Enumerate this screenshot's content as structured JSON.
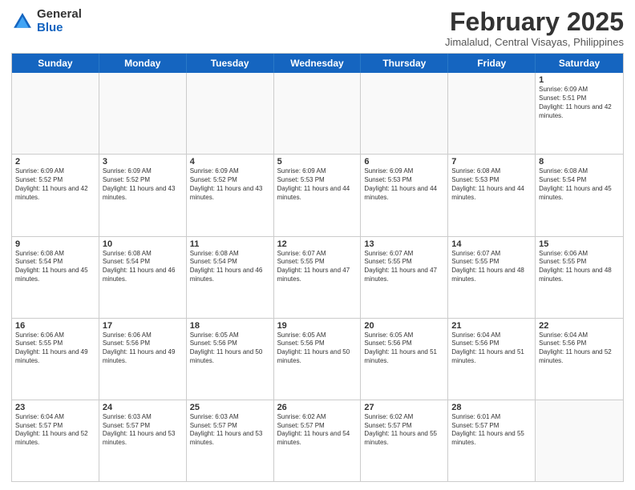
{
  "logo": {
    "general": "General",
    "blue": "Blue"
  },
  "title": "February 2025",
  "subtitle": "Jimalalud, Central Visayas, Philippines",
  "days_of_week": [
    "Sunday",
    "Monday",
    "Tuesday",
    "Wednesday",
    "Thursday",
    "Friday",
    "Saturday"
  ],
  "weeks": [
    [
      {
        "day": "",
        "empty": true
      },
      {
        "day": "",
        "empty": true
      },
      {
        "day": "",
        "empty": true
      },
      {
        "day": "",
        "empty": true
      },
      {
        "day": "",
        "empty": true
      },
      {
        "day": "",
        "empty": true
      },
      {
        "day": "1",
        "sunrise": "Sunrise: 6:09 AM",
        "sunset": "Sunset: 5:51 PM",
        "daylight": "Daylight: 11 hours and 42 minutes."
      }
    ],
    [
      {
        "day": "2",
        "sunrise": "Sunrise: 6:09 AM",
        "sunset": "Sunset: 5:52 PM",
        "daylight": "Daylight: 11 hours and 42 minutes."
      },
      {
        "day": "3",
        "sunrise": "Sunrise: 6:09 AM",
        "sunset": "Sunset: 5:52 PM",
        "daylight": "Daylight: 11 hours and 43 minutes."
      },
      {
        "day": "4",
        "sunrise": "Sunrise: 6:09 AM",
        "sunset": "Sunset: 5:52 PM",
        "daylight": "Daylight: 11 hours and 43 minutes."
      },
      {
        "day": "5",
        "sunrise": "Sunrise: 6:09 AM",
        "sunset": "Sunset: 5:53 PM",
        "daylight": "Daylight: 11 hours and 44 minutes."
      },
      {
        "day": "6",
        "sunrise": "Sunrise: 6:09 AM",
        "sunset": "Sunset: 5:53 PM",
        "daylight": "Daylight: 11 hours and 44 minutes."
      },
      {
        "day": "7",
        "sunrise": "Sunrise: 6:08 AM",
        "sunset": "Sunset: 5:53 PM",
        "daylight": "Daylight: 11 hours and 44 minutes."
      },
      {
        "day": "8",
        "sunrise": "Sunrise: 6:08 AM",
        "sunset": "Sunset: 5:54 PM",
        "daylight": "Daylight: 11 hours and 45 minutes."
      }
    ],
    [
      {
        "day": "9",
        "sunrise": "Sunrise: 6:08 AM",
        "sunset": "Sunset: 5:54 PM",
        "daylight": "Daylight: 11 hours and 45 minutes."
      },
      {
        "day": "10",
        "sunrise": "Sunrise: 6:08 AM",
        "sunset": "Sunset: 5:54 PM",
        "daylight": "Daylight: 11 hours and 46 minutes."
      },
      {
        "day": "11",
        "sunrise": "Sunrise: 6:08 AM",
        "sunset": "Sunset: 5:54 PM",
        "daylight": "Daylight: 11 hours and 46 minutes."
      },
      {
        "day": "12",
        "sunrise": "Sunrise: 6:07 AM",
        "sunset": "Sunset: 5:55 PM",
        "daylight": "Daylight: 11 hours and 47 minutes."
      },
      {
        "day": "13",
        "sunrise": "Sunrise: 6:07 AM",
        "sunset": "Sunset: 5:55 PM",
        "daylight": "Daylight: 11 hours and 47 minutes."
      },
      {
        "day": "14",
        "sunrise": "Sunrise: 6:07 AM",
        "sunset": "Sunset: 5:55 PM",
        "daylight": "Daylight: 11 hours and 48 minutes."
      },
      {
        "day": "15",
        "sunrise": "Sunrise: 6:06 AM",
        "sunset": "Sunset: 5:55 PM",
        "daylight": "Daylight: 11 hours and 48 minutes."
      }
    ],
    [
      {
        "day": "16",
        "sunrise": "Sunrise: 6:06 AM",
        "sunset": "Sunset: 5:55 PM",
        "daylight": "Daylight: 11 hours and 49 minutes."
      },
      {
        "day": "17",
        "sunrise": "Sunrise: 6:06 AM",
        "sunset": "Sunset: 5:56 PM",
        "daylight": "Daylight: 11 hours and 49 minutes."
      },
      {
        "day": "18",
        "sunrise": "Sunrise: 6:05 AM",
        "sunset": "Sunset: 5:56 PM",
        "daylight": "Daylight: 11 hours and 50 minutes."
      },
      {
        "day": "19",
        "sunrise": "Sunrise: 6:05 AM",
        "sunset": "Sunset: 5:56 PM",
        "daylight": "Daylight: 11 hours and 50 minutes."
      },
      {
        "day": "20",
        "sunrise": "Sunrise: 6:05 AM",
        "sunset": "Sunset: 5:56 PM",
        "daylight": "Daylight: 11 hours and 51 minutes."
      },
      {
        "day": "21",
        "sunrise": "Sunrise: 6:04 AM",
        "sunset": "Sunset: 5:56 PM",
        "daylight": "Daylight: 11 hours and 51 minutes."
      },
      {
        "day": "22",
        "sunrise": "Sunrise: 6:04 AM",
        "sunset": "Sunset: 5:56 PM",
        "daylight": "Daylight: 11 hours and 52 minutes."
      }
    ],
    [
      {
        "day": "23",
        "sunrise": "Sunrise: 6:04 AM",
        "sunset": "Sunset: 5:57 PM",
        "daylight": "Daylight: 11 hours and 52 minutes."
      },
      {
        "day": "24",
        "sunrise": "Sunrise: 6:03 AM",
        "sunset": "Sunset: 5:57 PM",
        "daylight": "Daylight: 11 hours and 53 minutes."
      },
      {
        "day": "25",
        "sunrise": "Sunrise: 6:03 AM",
        "sunset": "Sunset: 5:57 PM",
        "daylight": "Daylight: 11 hours and 53 minutes."
      },
      {
        "day": "26",
        "sunrise": "Sunrise: 6:02 AM",
        "sunset": "Sunset: 5:57 PM",
        "daylight": "Daylight: 11 hours and 54 minutes."
      },
      {
        "day": "27",
        "sunrise": "Sunrise: 6:02 AM",
        "sunset": "Sunset: 5:57 PM",
        "daylight": "Daylight: 11 hours and 55 minutes."
      },
      {
        "day": "28",
        "sunrise": "Sunrise: 6:01 AM",
        "sunset": "Sunset: 5:57 PM",
        "daylight": "Daylight: 11 hours and 55 minutes."
      },
      {
        "day": "",
        "empty": true
      }
    ]
  ]
}
